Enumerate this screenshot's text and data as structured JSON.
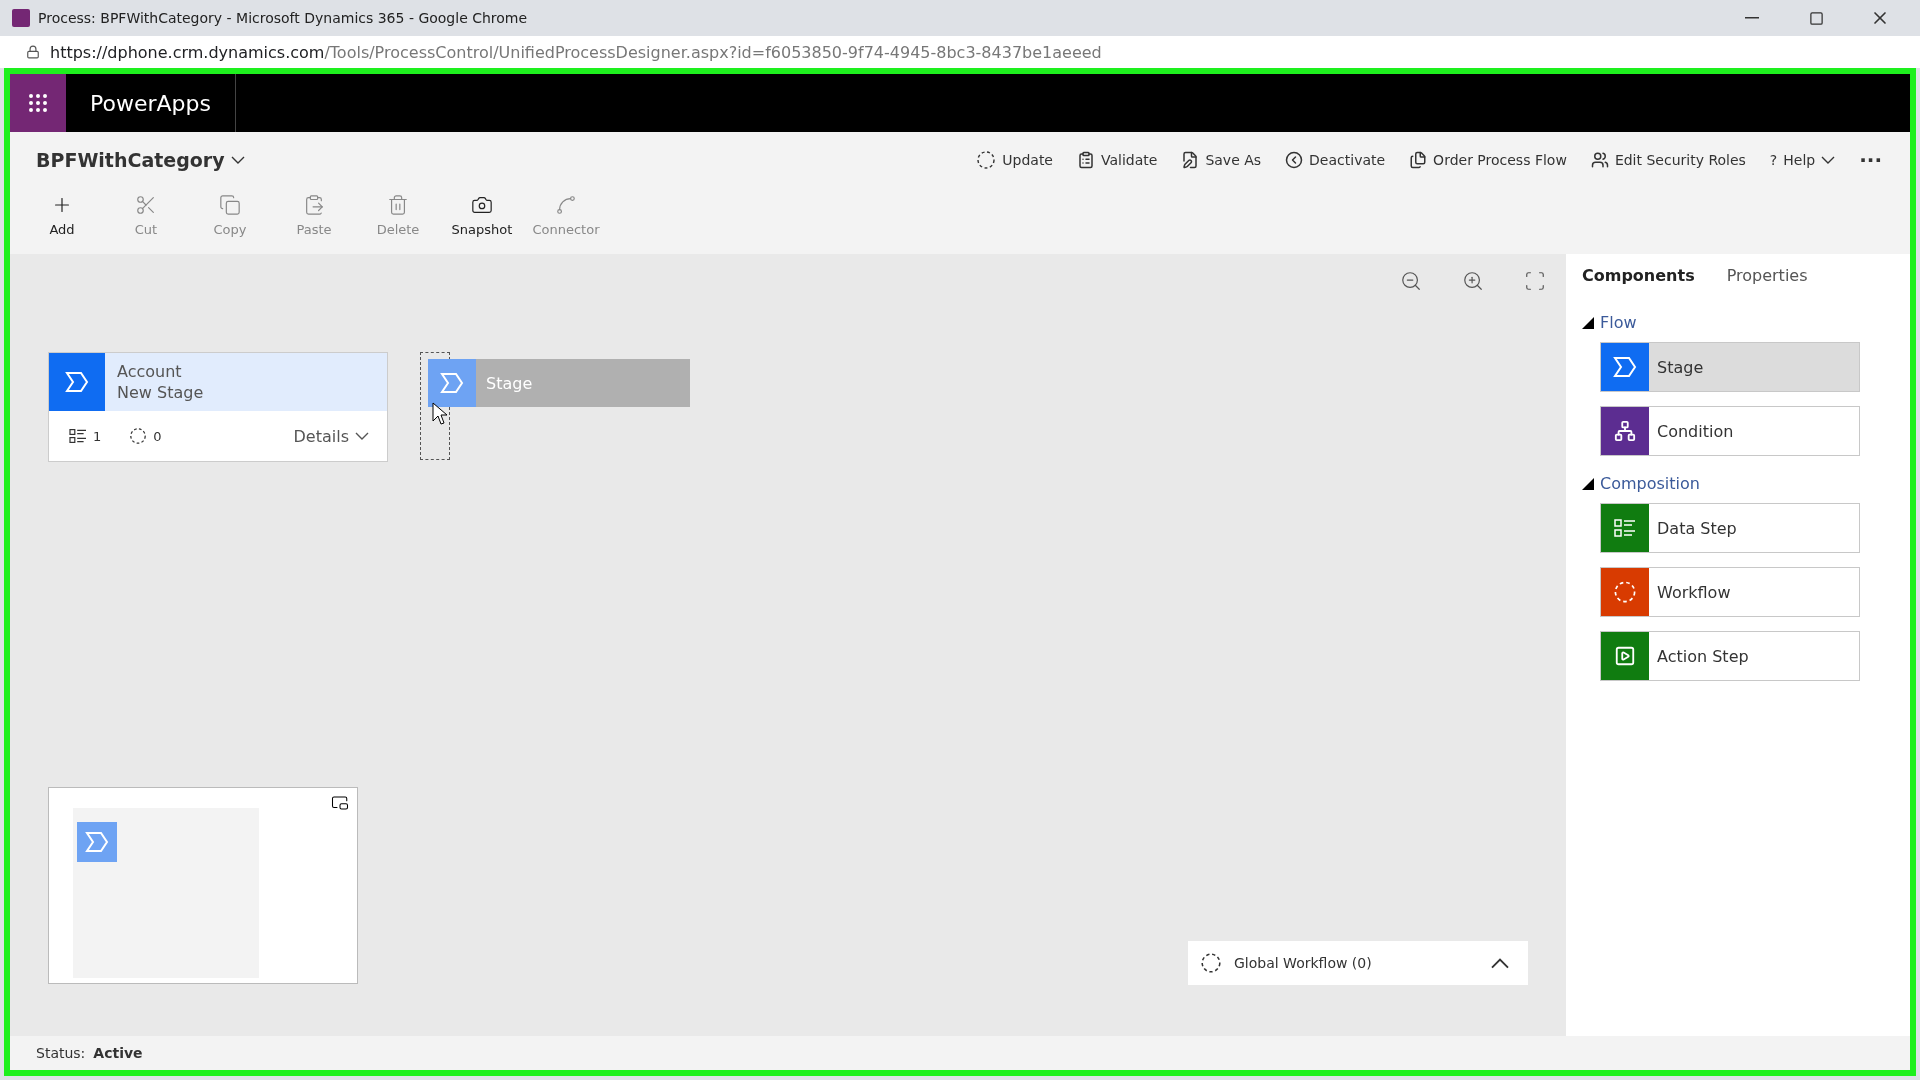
{
  "browser": {
    "title": "Process: BPFWithCategory - Microsoft Dynamics 365 - Google Chrome",
    "url_host": "https://dphone.crm.dynamics.com",
    "url_path": "/Tools/ProcessControl/UnifiedProcessDesigner.aspx?id=f6053850-9f74-4945-8bc3-8437be1aeeed"
  },
  "app": {
    "name": "PowerApps"
  },
  "process": {
    "name": "BPFWithCategory"
  },
  "actions": [
    {
      "kind": "update",
      "label": "Update"
    },
    {
      "kind": "validate",
      "label": "Validate"
    },
    {
      "kind": "saveas",
      "label": "Save As"
    },
    {
      "kind": "deactivate",
      "label": "Deactivate"
    },
    {
      "kind": "order",
      "label": "Order Process Flow"
    },
    {
      "kind": "roles",
      "label": "Edit Security Roles"
    },
    {
      "kind": "help",
      "label": "Help",
      "icon": "?"
    },
    {
      "kind": "more",
      "label": "···"
    }
  ],
  "toolbar": [
    {
      "kind": "add",
      "label": "Add",
      "disabled": false
    },
    {
      "kind": "cut",
      "label": "Cut",
      "disabled": true
    },
    {
      "kind": "copy",
      "label": "Copy",
      "disabled": true
    },
    {
      "kind": "paste",
      "label": "Paste",
      "disabled": true
    },
    {
      "kind": "delete",
      "label": "Delete",
      "disabled": true
    },
    {
      "kind": "snapshot",
      "label": "Snapshot",
      "disabled": false
    },
    {
      "kind": "connector",
      "label": "Connector",
      "disabled": true
    }
  ],
  "canvas": {
    "stage_card": {
      "entity": "Account",
      "name": "New Stage",
      "steps": "1",
      "workflows": "0",
      "details": "Details"
    },
    "drag_ghost": {
      "label": "Stage"
    },
    "global_workflow": {
      "label": "Global Workflow (0)",
      "expanded": false
    }
  },
  "panel": {
    "tabs": [
      {
        "label": "Components",
        "selected": true
      },
      {
        "label": "Properties",
        "selected": false
      }
    ],
    "sections": [
      {
        "title": "Flow",
        "expanded": true,
        "items": [
          {
            "kind": "stage",
            "label": "Stage",
            "color": "#0f6cf2",
            "selected": true
          },
          {
            "kind": "condition",
            "label": "Condition",
            "color": "#5c2d91",
            "selected": false
          }
        ]
      },
      {
        "title": "Composition",
        "expanded": true,
        "items": [
          {
            "kind": "datastep",
            "label": "Data Step",
            "color": "#107c10",
            "selected": false
          },
          {
            "kind": "workflow",
            "label": "Workflow",
            "color": "#d83b01",
            "selected": false
          },
          {
            "kind": "actionstep",
            "label": "Action Step",
            "color": "#107c10",
            "selected": false
          }
        ]
      }
    ]
  },
  "status": {
    "label": "Status:",
    "value": "Active"
  }
}
